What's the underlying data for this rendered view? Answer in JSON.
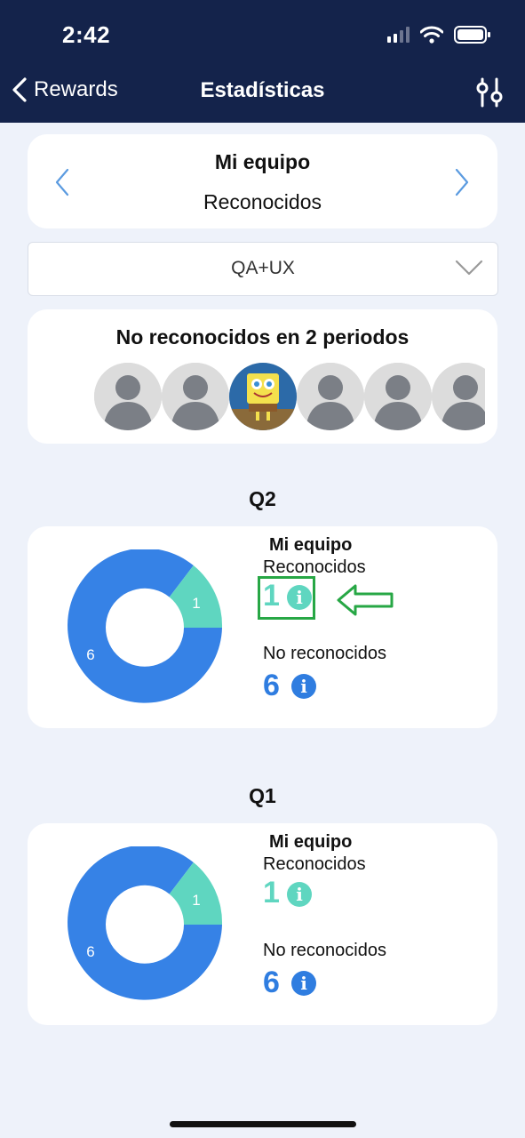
{
  "status_bar": {
    "time": "2:42"
  },
  "nav": {
    "back_label": "Rewards",
    "title": "Estadísticas"
  },
  "team_selector": {
    "title": "Mi equipo",
    "subtitle": "Reconocidos"
  },
  "dropdown": {
    "value": "QA+UX"
  },
  "not_recognized": {
    "title": "No reconocidos en 2 periodos",
    "avatars": [
      "placeholder",
      "placeholder",
      "spongebob",
      "placeholder",
      "placeholder",
      "placeholder"
    ]
  },
  "quarters": [
    {
      "label": "Q2",
      "team": "Mi equipo",
      "recognized_label": "Reconocidos",
      "recognized_count": "1",
      "not_recognized_label": "No reconocidos",
      "not_recognized_count": "6",
      "donut_recognized": "1",
      "donut_not_recognized": "6"
    },
    {
      "label": "Q1",
      "team": "Mi equipo",
      "recognized_label": "Reconocidos",
      "recognized_count": "1",
      "not_recognized_label": "No reconocidos",
      "not_recognized_count": "6",
      "donut_recognized": "1",
      "donut_not_recognized": "6"
    }
  ],
  "info_icon_glyph": "i",
  "colors": {
    "header": "#14234B",
    "recognized": "#5FD6C0",
    "not_recognized": "#2F7DE0",
    "highlight": "#27A745"
  }
}
